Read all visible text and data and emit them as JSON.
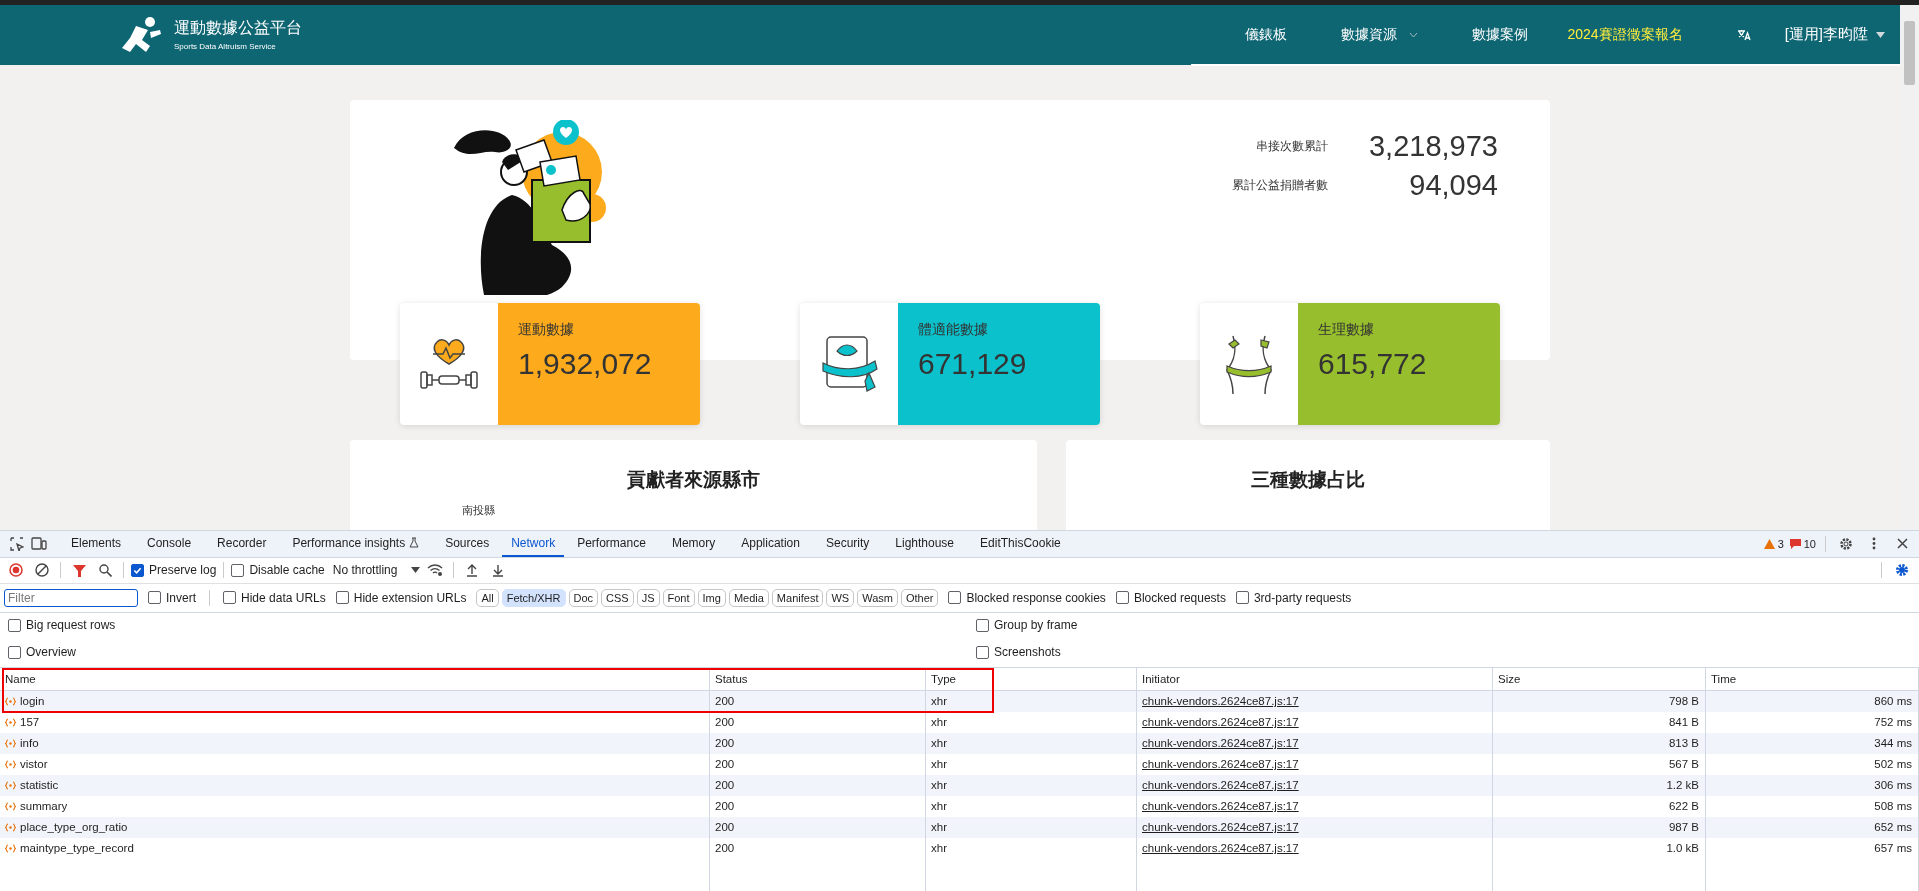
{
  "header": {
    "logo_title": "運動數據公益平台",
    "logo_subtitle": "Sports Data Altruism Service",
    "nav": [
      {
        "label": "儀錶板",
        "dropdown": false,
        "highlighted": false
      },
      {
        "label": "數據資源",
        "dropdown": true,
        "highlighted": false
      },
      {
        "label": "數據案例",
        "dropdown": false,
        "highlighted": false
      },
      {
        "label": "2024賽證徵案報名",
        "dropdown": false,
        "highlighted": true
      }
    ],
    "user": {
      "label": "[運用]李昀陞",
      "dropdown": true
    }
  },
  "summary": {
    "stats": [
      {
        "label": "串接次數累計",
        "value": "3,218,973"
      },
      {
        "label": "累計公益捐贈者數",
        "value": "94,094"
      }
    ]
  },
  "metrics": [
    {
      "kind": "exercise",
      "label": "運動數據",
      "value": "1,932,072",
      "color": "#fdab1c"
    },
    {
      "kind": "fitness",
      "label": "體適能數據",
      "value": "671,129",
      "color": "#0bc1cb"
    },
    {
      "kind": "physiology",
      "label": "生理數據",
      "value": "615,772",
      "color": "#97be2c"
    }
  ],
  "panels": [
    {
      "title": "貢獻者來源縣市",
      "items": [
        "南投縣"
      ]
    },
    {
      "title": "三種數據占比"
    }
  ],
  "devtools": {
    "tabs": [
      {
        "label": "Elements",
        "selected": false
      },
      {
        "label": "Console",
        "selected": false
      },
      {
        "label": "Recorder",
        "selected": false
      },
      {
        "label": "Performance insights",
        "selected": false
      },
      {
        "label": "Sources",
        "selected": false
      },
      {
        "label": "Network",
        "selected": true
      },
      {
        "label": "Performance",
        "selected": false
      },
      {
        "label": "Memory",
        "selected": false
      },
      {
        "label": "Application",
        "selected": false
      },
      {
        "label": "Security",
        "selected": false
      },
      {
        "label": "Lighthouse",
        "selected": false
      },
      {
        "label": "EditThisCookie",
        "selected": false
      }
    ],
    "warnings": "3",
    "errors": "10",
    "toolbar": {
      "preserve_log": {
        "label": "Preserve log",
        "checked": true
      },
      "disable_cache": {
        "label": "Disable cache",
        "checked": false
      },
      "throttling": "No throttling"
    },
    "filter": {
      "placeholder": "Filter",
      "options": [
        {
          "label": "Invert",
          "checked": false
        },
        {
          "label": "Hide data URLs",
          "checked": false
        },
        {
          "label": "Hide extension URLs",
          "checked": false
        }
      ],
      "types": [
        {
          "label": "All",
          "selected": false
        },
        {
          "label": "Fetch/XHR",
          "selected": true
        },
        {
          "label": "Doc",
          "selected": false
        },
        {
          "label": "CSS",
          "selected": false
        },
        {
          "label": "JS",
          "selected": false
        },
        {
          "label": "Font",
          "selected": false
        },
        {
          "label": "Img",
          "selected": false
        },
        {
          "label": "Media",
          "selected": false
        },
        {
          "label": "Manifest",
          "selected": false
        },
        {
          "label": "WS",
          "selected": false
        },
        {
          "label": "Wasm",
          "selected": false
        },
        {
          "label": "Other",
          "selected": false
        }
      ],
      "extra": [
        {
          "label": "Blocked response cookies",
          "checked": false
        },
        {
          "label": "Blocked requests",
          "checked": false
        },
        {
          "label": "3rd-party requests",
          "checked": false
        }
      ]
    },
    "settings": [
      {
        "label": "Big request rows",
        "checked": false
      },
      {
        "label": "Group by frame",
        "checked": false
      },
      {
        "label": "Overview",
        "checked": false
      },
      {
        "label": "Screenshots",
        "checked": false
      }
    ],
    "table": {
      "columns": [
        "Name",
        "Status",
        "Type",
        "Initiator",
        "Size",
        "Time"
      ],
      "rows": [
        [
          "login",
          "200",
          "xhr",
          "chunk-vendors.2624ce87.js:17",
          "798 B",
          "860 ms"
        ],
        [
          "157",
          "200",
          "xhr",
          "chunk-vendors.2624ce87.js:17",
          "841 B",
          "752 ms"
        ],
        [
          "info",
          "200",
          "xhr",
          "chunk-vendors.2624ce87.js:17",
          "813 B",
          "344 ms"
        ],
        [
          "vistor",
          "200",
          "xhr",
          "chunk-vendors.2624ce87.js:17",
          "567 B",
          "502 ms"
        ],
        [
          "statistic",
          "200",
          "xhr",
          "chunk-vendors.2624ce87.js:17",
          "1.2 kB",
          "306 ms"
        ],
        [
          "summary",
          "200",
          "xhr",
          "chunk-vendors.2624ce87.js:17",
          "622 B",
          "508 ms"
        ],
        [
          "place_type_org_ratio",
          "200",
          "xhr",
          "chunk-vendors.2624ce87.js:17",
          "987 B",
          "652 ms"
        ],
        [
          "maintype_type_record",
          "200",
          "xhr",
          "chunk-vendors.2624ce87.js:17",
          "1.0 kB",
          "657 ms"
        ]
      ]
    }
  }
}
